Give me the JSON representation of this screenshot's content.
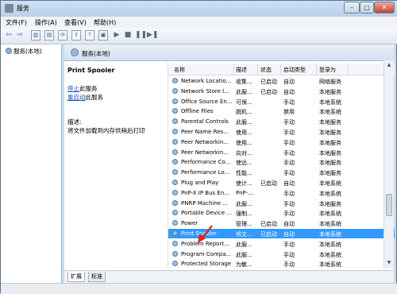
{
  "window": {
    "title": "服务"
  },
  "menu": [
    "文件(F)",
    "操作(A)",
    "查看(V)",
    "帮助(H)"
  ],
  "toolbar_icons": [
    "back-arrow-icon",
    "forward-arrow-icon",
    "show-hide-tree-icon",
    "properties-icon",
    "refresh-icon",
    "export-icon",
    "help-icon",
    "console-icon",
    "play-icon",
    "stop-icon",
    "pause-icon",
    "restart-icon"
  ],
  "tree": {
    "item": "服务(本地)"
  },
  "header": {
    "title": "服务(本地)"
  },
  "details": {
    "service_name": "Print Spooler",
    "stop_link": "停止",
    "stop_suffix": "此服务",
    "restart_link": "重启动",
    "restart_suffix": "此服务",
    "desc_label": "描述:",
    "desc_text": "将文件加载到内存供稍后打印"
  },
  "table": {
    "columns": [
      "名称",
      "描述",
      "状态",
      "启动类型",
      "登录为"
    ],
    "rows": [
      {
        "name": "Network Locatio...",
        "desc": "收集...",
        "status": "已启动",
        "startup": "自动",
        "logon": "网络服务"
      },
      {
        "name": "Network Store I...",
        "desc": "此服...",
        "status": "已启动",
        "startup": "自动",
        "logon": "本地服务"
      },
      {
        "name": "Office Source En...",
        "desc": "可保...",
        "status": "",
        "startup": "手动",
        "logon": "本地系统"
      },
      {
        "name": "Offline Files",
        "desc": "脱机...",
        "status": "",
        "startup": "禁用",
        "logon": "本地系统"
      },
      {
        "name": "Parental Controls",
        "desc": "此服...",
        "status": "",
        "startup": "手动",
        "logon": "本地服务"
      },
      {
        "name": "Peer Name Res...",
        "desc": "使用...",
        "status": "",
        "startup": "手动",
        "logon": "本地服务"
      },
      {
        "name": "Peer Networkin...",
        "desc": "使用...",
        "status": "",
        "startup": "手动",
        "logon": "本地服务"
      },
      {
        "name": "Peer Networkin...",
        "desc": "向对...",
        "status": "",
        "startup": "手动",
        "logon": "本地服务"
      },
      {
        "name": "Performance Co...",
        "desc": "使远...",
        "status": "",
        "startup": "手动",
        "logon": "本地服务"
      },
      {
        "name": "Performance Lo...",
        "desc": "性能...",
        "status": "",
        "startup": "手动",
        "logon": "本地服务"
      },
      {
        "name": "Plug and Play",
        "desc": "使计...",
        "status": "已启动",
        "startup": "自动",
        "logon": "本地系统"
      },
      {
        "name": "PnP-X IP Bus En...",
        "desc": "PnP-...",
        "status": "",
        "startup": "手动",
        "logon": "本地系统"
      },
      {
        "name": "PNRP Machine ...",
        "desc": "此服...",
        "status": "",
        "startup": "手动",
        "logon": "本地服务"
      },
      {
        "name": "Portable Device ...",
        "desc": "强制...",
        "status": "",
        "startup": "手动",
        "logon": "本地系统"
      },
      {
        "name": "Power",
        "desc": "管理...",
        "status": "已启动",
        "startup": "自动",
        "logon": "本地系统"
      },
      {
        "name": "Print Spooler",
        "desc": "将文...",
        "status": "已启动",
        "startup": "自动",
        "logon": "本地系统"
      },
      {
        "name": "Problem Report...",
        "desc": "此服...",
        "status": "",
        "startup": "手动",
        "logon": "本地系统"
      },
      {
        "name": "Program Compa...",
        "desc": "此服...",
        "status": "",
        "startup": "手动",
        "logon": "本地系统"
      },
      {
        "name": "Protected Storage",
        "desc": "为敏...",
        "status": "",
        "startup": "手动",
        "logon": "本地系统"
      }
    ],
    "selected_index": 15
  },
  "tabs": [
    "扩展",
    "标准"
  ],
  "colors": {
    "selection": "#3399ff",
    "link": "#1f52b8",
    "arrow": "#e0241b"
  }
}
